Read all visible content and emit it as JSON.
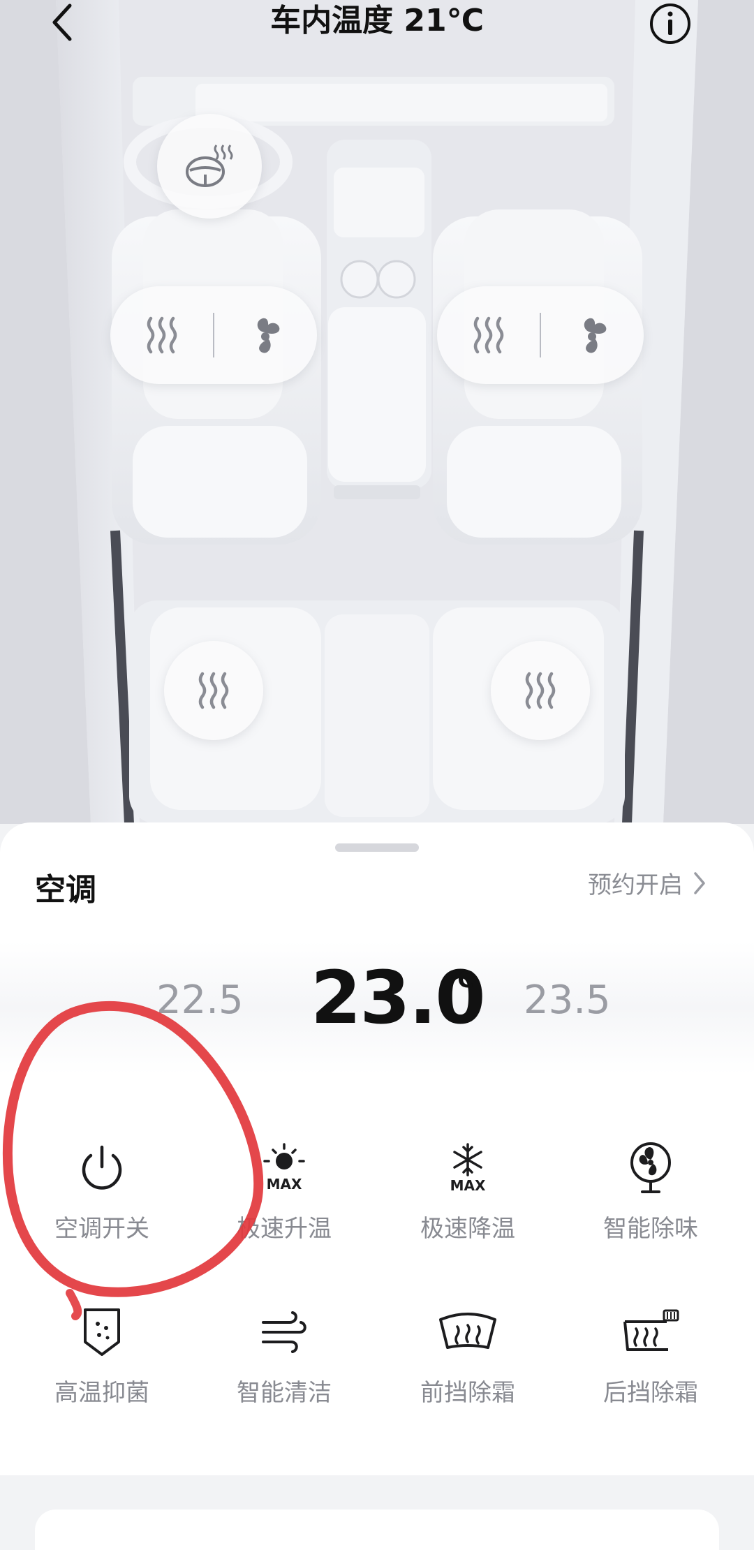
{
  "header": {
    "title": "车内温度 21℃",
    "back_icon": "chevron-left-icon",
    "info_icon": "info-icon"
  },
  "car_controls": {
    "steering_heat_icon": "steering-wheel-heat-icon",
    "front_left": {
      "heat_icon": "seat-heat-icon",
      "vent_icon": "fan-icon"
    },
    "front_right": {
      "heat_icon": "seat-heat-icon",
      "vent_icon": "fan-icon"
    },
    "rear_left": {
      "heat_icon": "seat-heat-icon"
    },
    "rear_right": {
      "heat_icon": "seat-heat-icon"
    }
  },
  "ac": {
    "title": "空调",
    "schedule_label": "预约开启",
    "temp_lower": "22.5",
    "temp_current": "23.0",
    "temp_unit": "℃",
    "temp_higher": "23.5",
    "functions": [
      {
        "label": "空调开关",
        "icon": "power-icon"
      },
      {
        "label": "极速升温",
        "icon": "sun-max-icon"
      },
      {
        "label": "极速降温",
        "icon": "snowflake-max-icon"
      },
      {
        "label": "智能除味",
        "icon": "fan-circle-icon"
      },
      {
        "label": "高温抑菌",
        "icon": "shield-dots-icon"
      },
      {
        "label": "智能清洁",
        "icon": "wind-icon"
      },
      {
        "label": "前挡除霜",
        "icon": "front-defrost-icon"
      },
      {
        "label": "后挡除霜",
        "icon": "rear-defrost-icon"
      }
    ]
  },
  "colors": {
    "annotation": "#e2373c",
    "accent_text": "#111111",
    "muted_text": "#8a8c93",
    "scene_bg": "#e7e8ed"
  }
}
